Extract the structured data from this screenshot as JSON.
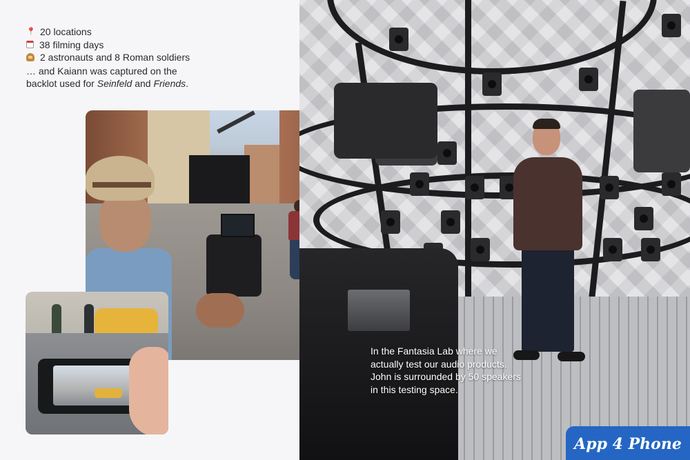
{
  "facts": {
    "items": [
      {
        "icon": "pin-icon",
        "text": "20 locations"
      },
      {
        "icon": "calendar-icon",
        "text": "38 filming days"
      },
      {
        "icon": "soldier-icon",
        "text": "2 astronauts and 8 Roman soldiers"
      }
    ],
    "caption_line1": "… and Kaiann was captured on the",
    "caption_line2_prefix": "backlot used for ",
    "caption_show1": "Seinfeld",
    "caption_and": " and ",
    "caption_show2": "Friends",
    "caption_end": "."
  },
  "lab": {
    "caption_lines": [
      "In the Fantasia Lab where we",
      "actually test our audio products.",
      "John is surrounded by 50 speakers",
      "in this testing space."
    ]
  },
  "watermark": {
    "text": "App 4 Phone",
    "color": "#2566c4"
  },
  "colors": {
    "background": "#f6f6f8",
    "text": "#2b2b2d"
  }
}
